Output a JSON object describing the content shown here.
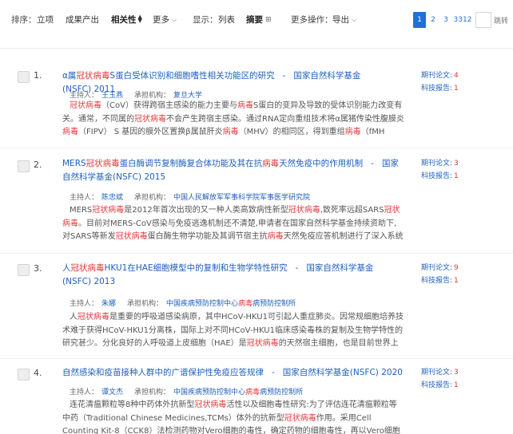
{
  "toolbar": {
    "sort_label": "排序：",
    "sort_options": [
      "立项",
      "成果产出",
      "相关性",
      "更多"
    ],
    "display_label": "显示：",
    "display_options": [
      "列表",
      "摘要"
    ],
    "more_actions_label": "更多操作：",
    "export_label": "导出"
  },
  "pager": {
    "pages": [
      "1",
      "2",
      "3",
      "3312"
    ],
    "current": "1",
    "jump_label": "跳转"
  },
  "results": [
    {
      "index": "1.",
      "title_segments": [
        {
          "t": "α属",
          "hl": false
        },
        {
          "t": "冠状病毒",
          "hl": true
        },
        {
          "t": "S蛋白受体识别和细胞嗜性相关功能区的研究",
          "hl": false
        }
      ],
      "separator": "-",
      "source": "国家自然科学基金(NSFC)",
      "year": "2011",
      "host_label": "主持人：",
      "host": "王玉燕",
      "org_label": "承担机构：",
      "org": "复旦大学",
      "abstract_segments": [
        {
          "t": "冠状病毒",
          "hl": true
        },
        {
          "t": "（CoV）获得跨宿主感染的能力主要与",
          "hl": false
        },
        {
          "t": "病毒",
          "hl": true
        },
        {
          "t": "S蛋白的变异及导致的受体识别能力改变有关。通常，不同属的",
          "hl": false
        },
        {
          "t": "冠状病毒",
          "hl": true
        },
        {
          "t": "不会产生跨宿主感染。通过RNA定向重组技术将α属猪传染性腹膜炎",
          "hl": false
        },
        {
          "t": "病毒",
          "hl": true
        },
        {
          "t": "（FIPV） S 基因的膜外区置换β属鼠肝炎",
          "hl": false
        },
        {
          "t": "病毒",
          "hl": true
        },
        {
          "t": "（MHV）的相同区，得到重组",
          "hl": false
        },
        {
          "t": "病毒",
          "hl": true
        },
        {
          "t": "（fMH",
          "hl": false
        }
      ],
      "paper_label": "期刊论文:",
      "paper_count": "4",
      "report_label": "科技报告:",
      "report_count": "1"
    },
    {
      "index": "2.",
      "title_segments": [
        {
          "t": "MERS",
          "hl": false
        },
        {
          "t": "冠状病毒",
          "hl": true
        },
        {
          "t": "蛋白酶调节复制酶复合体功能及其在抗",
          "hl": false
        },
        {
          "t": "病毒",
          "hl": true
        },
        {
          "t": "天然免疫中的作用机制",
          "hl": false
        }
      ],
      "separator": "-",
      "source": "国家自然科学基金(NSFC)",
      "year": "2015",
      "host_label": "主持人：",
      "host": "陈忠斌",
      "org_label": "承担机构：",
      "org": "中国人民解放军军事科学院军事医学研究院",
      "abstract_segments": [
        {
          "t": "MERS",
          "hl": false
        },
        {
          "t": "冠状病毒",
          "hl": true
        },
        {
          "t": "是2012年首次出现的又一种人类高致病性新型",
          "hl": false
        },
        {
          "t": "冠状病毒",
          "hl": true
        },
        {
          "t": ",致死率远超SARS",
          "hl": false
        },
        {
          "t": "冠状病毒",
          "hl": true
        },
        {
          "t": "。目前对MERS-CoV感染与免疫逃逸机制还不清楚,申请者在国家自然科学基金持续资助下,对SARS等新发",
          "hl": false
        },
        {
          "t": "冠状病毒",
          "hl": true
        },
        {
          "t": "蛋白酶生物学功能及其调节宿主抗",
          "hl": false
        },
        {
          "t": "病毒",
          "hl": true
        },
        {
          "t": "天然免疫应答机制进行了深入系统研究。主",
          "hl": false
        }
      ],
      "paper_label": "期刊论文:",
      "paper_count": "3",
      "report_label": "科技报告:",
      "report_count": "1"
    },
    {
      "index": "3.",
      "title_segments": [
        {
          "t": "人",
          "hl": false
        },
        {
          "t": "冠状病毒",
          "hl": true
        },
        {
          "t": "HKU1在HAE细胞模型中的复制和生物学特性研究",
          "hl": false
        }
      ],
      "separator": "-",
      "source": "国家自然科学基金(NSFC)",
      "year": "2013",
      "host_label": "主持人：",
      "host": "朱娜",
      "org_label": "承担机构：",
      "org_segments": [
        {
          "t": "中国疾病预防控制中心",
          "hl": false
        },
        {
          "t": "病毒",
          "hl": true
        },
        {
          "t": "病预防控制所",
          "hl": false
        }
      ],
      "abstract_segments": [
        {
          "t": "人",
          "hl": false
        },
        {
          "t": "冠状病毒",
          "hl": true
        },
        {
          "t": "是重要的呼吸道感染病原，其中HCoV-HKU1可引起人重症肺炎。因常规细胞培养技术难于获得HCoV-HKU1分离株，国际上对不同HCoV-HKU1临床感染毒株的复制及生物学特性的研究甚少。分化良好的人呼吸道上皮细胞（HAE）是",
          "hl": false
        },
        {
          "t": "冠状病毒",
          "hl": true
        },
        {
          "t": "的天然宿主细胞，也是目前世界上",
          "hl": false
        }
      ],
      "paper_label": "期刊论文:",
      "paper_count": "9",
      "report_label": "科技报告:",
      "report_count": "1"
    },
    {
      "index": "4.",
      "title_segments": [
        {
          "t": "自然感染和疫苗接种人群中的广谱保护性免疫应答规律",
          "hl": false
        }
      ],
      "separator": "-",
      "source": "国家自然科学基金(NSFC)",
      "year": "2020",
      "host_label": "主持人：",
      "host": "谭文杰",
      "org_label": "承担机构：",
      "org_segments": [
        {
          "t": "中国疾病预防控制中心",
          "hl": false
        },
        {
          "t": "病毒",
          "hl": true
        },
        {
          "t": "病预防控制所",
          "hl": false
        }
      ],
      "abstract_segments": [
        {
          "t": "连花清瘟颗粒等8种中药体外抗新型",
          "hl": false
        },
        {
          "t": "冠状病毒",
          "hl": true
        },
        {
          "t": "活性以及细胞毒性研究:为了评估连花清瘟颗粒等中药（Traditional Chinese Medicines,TCMs）体外的抗新型",
          "hl": false
        },
        {
          "t": "冠状病毒",
          "hl": true
        },
        {
          "t": "作用。采用Cell Counting Kit-8（CCK8）法检测药物对Vero细胞的毒性，确定药物的细胞毒性，再以Vero细胞为模型",
          "hl": false
        }
      ],
      "paper_label": "期刊论文:",
      "paper_count": "3",
      "report_label": "科技报告:",
      "report_count": "1"
    }
  ],
  "colors": {
    "link": "#1f5fbf",
    "highlight": "#e4393c",
    "pager_active": "#1e6fd9"
  }
}
